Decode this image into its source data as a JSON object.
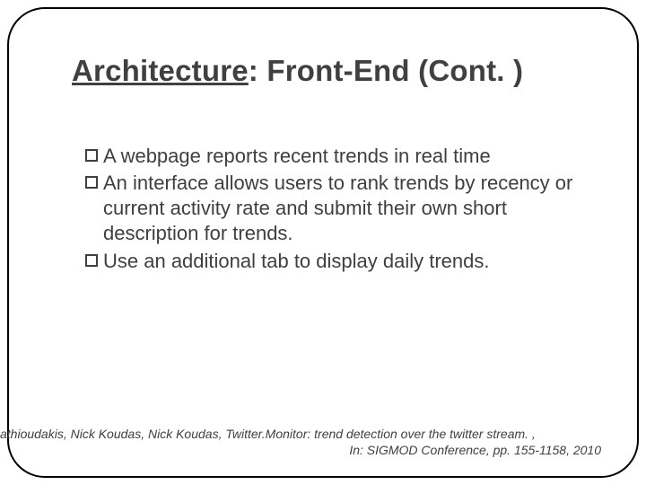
{
  "title": {
    "underlined": "Architecture",
    "rest": ": Front-End (Cont. )"
  },
  "bullets": [
    "A webpage reports recent trends in real time",
    "An interface allows users to rank trends by recency or current activity rate and submit their own short description for trends.",
    "Use an additional tab to display daily trends."
  ],
  "citation": {
    "line1": "athioudakis, Nick Koudas, Nick Koudas, Twitter.Monitor: trend detection over the twitter stream. ,",
    "line2": "In: SIGMOD Conference, pp. 155-1158, 2010"
  }
}
